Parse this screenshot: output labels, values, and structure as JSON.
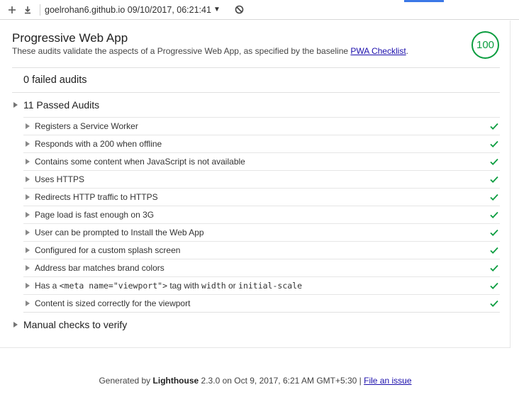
{
  "toolbar": {
    "plus_icon": "plus-icon",
    "download_icon": "download-icon",
    "report_title": "goelrohan6.github.io 09/10/2017, 06:21:41",
    "caret": "▼",
    "block_icon": "block-icon"
  },
  "category": {
    "title": "Progressive Web App",
    "description": "These audits validate the aspects of a Progressive Web App, as specified by the baseline",
    "link_text": "PWA Checklist",
    "period": ".",
    "score": "100",
    "score_color": "#0b9d3f"
  },
  "groups": {
    "failed": "0 failed audits",
    "passed": "11 Passed Audits",
    "manual": "Manual checks to verify"
  },
  "audits": [
    {
      "label": "Registers a Service Worker"
    },
    {
      "label": "Responds with a 200 when offline"
    },
    {
      "label": "Contains some content when JavaScript is not available"
    },
    {
      "label": "Uses HTTPS"
    },
    {
      "label": "Redirects HTTP traffic to HTTPS"
    },
    {
      "label": "Page load is fast enough on 3G"
    },
    {
      "label": "User can be prompted to Install the Web App"
    },
    {
      "label": "Configured for a custom splash screen"
    },
    {
      "label": "Address bar matches brand colors"
    },
    {
      "label_parts": [
        "Has a ",
        "<meta name=\"viewport\">",
        " tag with ",
        "width",
        " or ",
        "initial-scale"
      ]
    },
    {
      "label": "Content is sized correctly for the viewport"
    }
  ],
  "footer": {
    "generated_by": "Generated by",
    "tool": "Lighthouse",
    "rest": "2.3.0 on Oct 9, 2017, 6:21 AM GMT+5:30 |",
    "issue_link": "File an issue"
  }
}
